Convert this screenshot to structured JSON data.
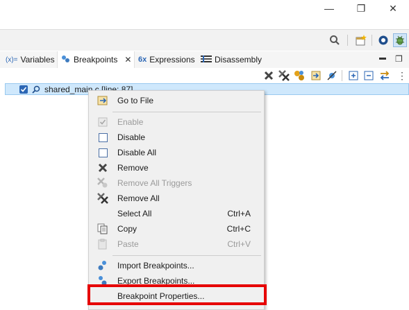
{
  "window": {
    "minimize_glyph": "—",
    "maximize_glyph": "❐",
    "close_glyph": "✕"
  },
  "main_toolbar": {
    "icons": [
      "search-icon",
      "open-perspective-icon",
      "debug-perspective-icon",
      "debug-bug-icon"
    ]
  },
  "tabs": [
    {
      "label": "Variables",
      "icon": "variables-icon",
      "icon_text": "(x)="
    },
    {
      "label": "Breakpoints",
      "icon": "breakpoints-icon",
      "close_glyph": "✕",
      "active": true
    },
    {
      "label": "Expressions",
      "icon": "expressions-icon",
      "icon_text": "6x"
    },
    {
      "label": "Disassembly",
      "icon": "disassembly-icon"
    }
  ],
  "view_controls": {
    "minimize_glyph": "▬",
    "maximize_glyph": "❐"
  },
  "view_toolbar": {
    "icons": [
      "remove-icon",
      "remove-all-icon",
      "link-icon",
      "go-to-file-icon",
      "skip-breakpoints-icon",
      "expand-all-icon",
      "collapse-all-icon",
      "link-with-debug-view-icon",
      "view-menu-icon"
    ]
  },
  "breakpoint_row": {
    "label": "shared_main.c [line: 87]",
    "checked": true
  },
  "context_menu": {
    "items": [
      {
        "label": "Go to File",
        "shortcut": "",
        "enabled": true,
        "icon": "go-to-file-icon"
      },
      {
        "label": "Enable",
        "shortcut": "",
        "enabled": false,
        "icon": "enable-check-icon"
      },
      {
        "label": "Disable",
        "shortcut": "",
        "enabled": true,
        "icon": "disable-checkbox-icon"
      },
      {
        "label": "Disable All",
        "shortcut": "",
        "enabled": true,
        "icon": "disable-all-checkbox-icon"
      },
      {
        "label": "Remove",
        "shortcut": "",
        "enabled": true,
        "icon": "remove-icon"
      },
      {
        "label": "Remove All Triggers",
        "shortcut": "",
        "enabled": false,
        "icon": "remove-all-triggers-icon"
      },
      {
        "label": "Remove All",
        "shortcut": "",
        "enabled": true,
        "icon": "remove-all-icon"
      },
      {
        "label": "Select All",
        "shortcut": "Ctrl+A",
        "enabled": true,
        "icon": ""
      },
      {
        "label": "Copy",
        "shortcut": "Ctrl+C",
        "enabled": true,
        "icon": "copy-icon"
      },
      {
        "label": "Paste",
        "shortcut": "Ctrl+V",
        "enabled": false,
        "icon": "paste-icon"
      },
      {
        "label": "Import Breakpoints...",
        "shortcut": "",
        "enabled": true,
        "icon": "import-breakpoints-icon"
      },
      {
        "label": "Export Breakpoints...",
        "shortcut": "",
        "enabled": true,
        "icon": "export-breakpoints-icon"
      },
      {
        "label": "Breakpoint Properties...",
        "shortcut": "",
        "enabled": true,
        "icon": ""
      }
    ]
  },
  "colors": {
    "highlight_border": "#e60000",
    "selection_bg": "#cfe8fc",
    "accent": "#2c67b5"
  }
}
